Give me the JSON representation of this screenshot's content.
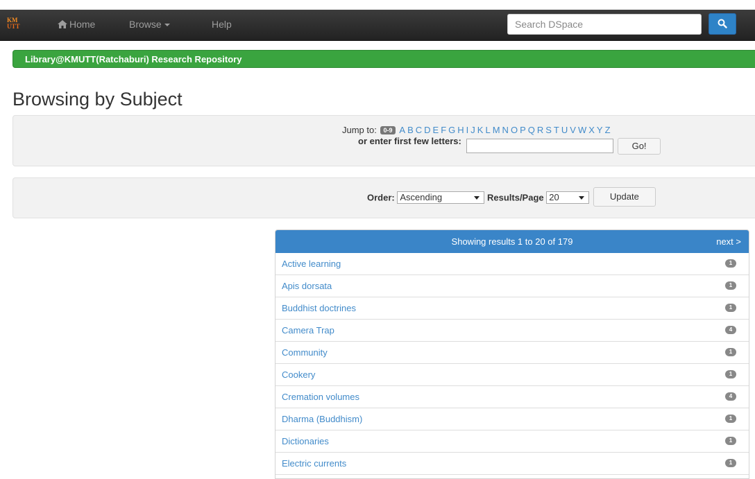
{
  "navbar": {
    "brand_top": "KM",
    "brand_bottom": "UTT",
    "home_label": "Home",
    "browse_label": "Browse",
    "help_label": "Help",
    "search_placeholder": "Search DSpace"
  },
  "repository": {
    "name": "Library@KMUTT(Ratchaburi) Research Repository"
  },
  "page": {
    "title": "Browsing by Subject"
  },
  "jump": {
    "label": "Jump to:",
    "digits_badge": "0-9",
    "letters": [
      "A",
      "B",
      "C",
      "D",
      "E",
      "F",
      "G",
      "H",
      "I",
      "J",
      "K",
      "L",
      "M",
      "N",
      "O",
      "P",
      "Q",
      "R",
      "S",
      "T",
      "U",
      "V",
      "W",
      "X",
      "Y",
      "Z"
    ],
    "enter_label": "or enter first few letters:",
    "input_value": "",
    "go_label": "Go!"
  },
  "order_controls": {
    "order_label": "Order:",
    "order_value": "Ascending",
    "rpp_label": "Results/Page",
    "rpp_value": "20",
    "update_label": "Update"
  },
  "results": {
    "showing_text": "Showing results 1 to 20 of 179",
    "next_label": "next >",
    "items": [
      {
        "subject": "Active learning",
        "count": "1"
      },
      {
        "subject": "Apis dorsata",
        "count": "1"
      },
      {
        "subject": "Buddhist doctrines",
        "count": "1"
      },
      {
        "subject": "Camera Trap",
        "count": "4"
      },
      {
        "subject": "Community",
        "count": "1"
      },
      {
        "subject": "Cookery",
        "count": "1"
      },
      {
        "subject": "Cremation volumes",
        "count": "4"
      },
      {
        "subject": "Dharma (Buddhism)",
        "count": "1"
      },
      {
        "subject": "Dictionaries",
        "count": "1"
      },
      {
        "subject": "Electric currents",
        "count": "1"
      }
    ]
  },
  "colors": {
    "navbar": "#222222",
    "repo_bar": "#3aa43f",
    "accent": "#3a85c8",
    "link": "#428bca"
  }
}
